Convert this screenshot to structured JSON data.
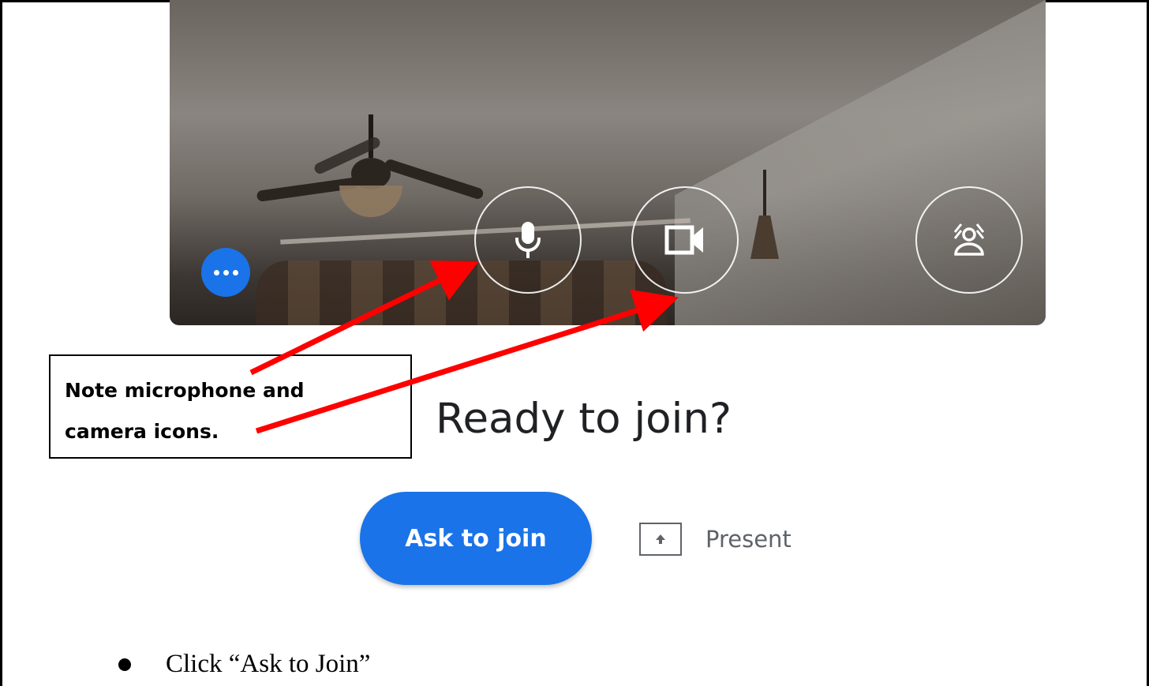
{
  "preview": {
    "more_options_icon": "more-horizontal-icon",
    "microphone_icon": "microphone-icon",
    "camera_icon": "videocam-icon",
    "effects_icon": "visual-effects-icon"
  },
  "annotation": {
    "note_text": "Note microphone and camera icons.",
    "arrow_color": "#ff0000"
  },
  "join": {
    "title": "Ready to join?",
    "ask_button_label": "Ask to join",
    "present_label": "Present",
    "present_icon": "present-upload-icon"
  },
  "instruction": {
    "bullet_text": "Click “Ask to Join”"
  },
  "colors": {
    "accent": "#1a73e8",
    "title_text": "#202124",
    "secondary_text": "#5f6368"
  }
}
